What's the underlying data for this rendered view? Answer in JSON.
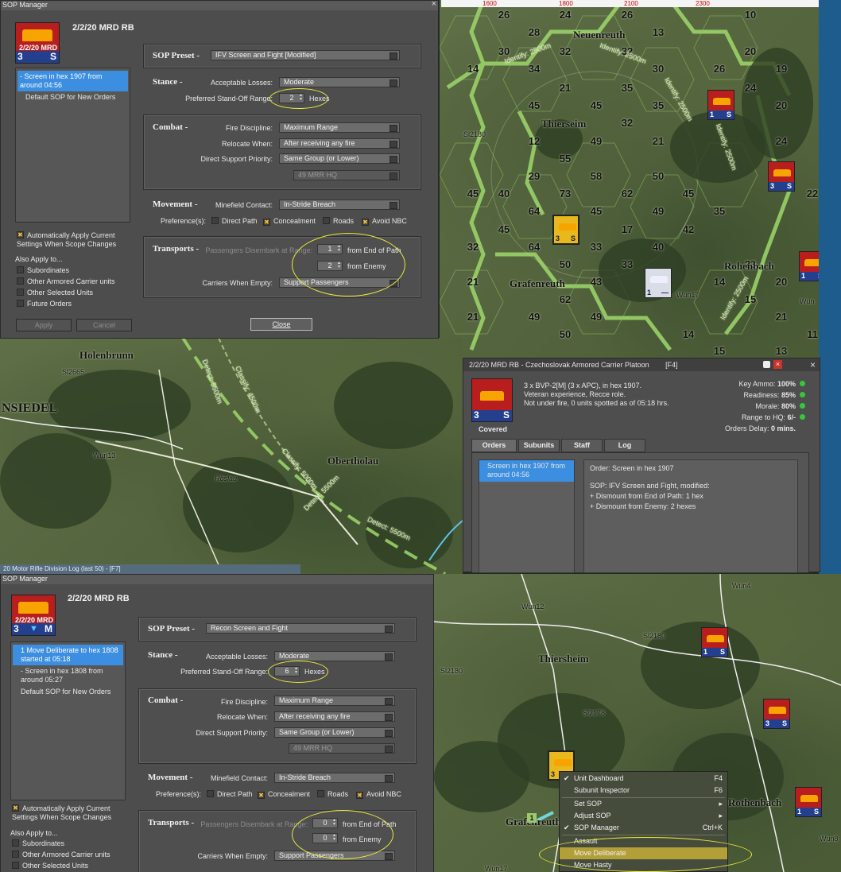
{
  "top_map": {
    "ruler": [
      "1600",
      "1800",
      "2100",
      "2300"
    ],
    "hex_numbers": [
      "26",
      "24",
      "26",
      "10",
      "28",
      "32",
      "13",
      "30",
      "32",
      "30",
      "20",
      "14",
      "34",
      "21",
      "35",
      "26",
      "24",
      "19",
      "45",
      "45",
      "35",
      "20",
      "12",
      "49",
      "32",
      "24",
      "29",
      "55",
      "58",
      "50",
      "40",
      "73",
      "62",
      "45",
      "35",
      "22",
      "64",
      "45",
      "49",
      "42",
      "45",
      "64",
      "33",
      "17",
      "32",
      "50",
      "33",
      "23",
      "20",
      "21",
      "43",
      "21",
      "14",
      "15",
      "62",
      "49",
      "49",
      "21",
      "50",
      "14",
      "21",
      "11",
      "15",
      "13",
      "40",
      "45"
    ],
    "towns": [
      "Neuenreuth",
      "Thierseim",
      "Grafenreuth",
      "Rohenbach"
    ],
    "roads": [
      "Sl2180",
      "Wun17",
      "Wun"
    ],
    "detect": [
      "Identify: 2500m",
      "Identify: 2500m",
      "Identify: 2500m",
      "Identify: 2500m",
      "Identify: 2500m"
    ]
  },
  "mid_map": {
    "towns": [
      "Holenbrunn",
      "NSIEDEL",
      "Obertholau"
    ],
    "roads": [
      "Sl2665",
      "Wun13",
      "Röslau"
    ],
    "detect": [
      "Detect: 5500m",
      "Classify: 4500m",
      "Classify: 5000m",
      "Detect: 5500m",
      "Detect: 5500m"
    ],
    "log_title": "20 Motor Rifle Division Log (last 50) - [F7]"
  },
  "sop1": {
    "title": "SOP Manager",
    "unit": "2/2/20 MRD RB",
    "counter": {
      "top": "T",
      "label": "2/2/20 MRD",
      "size": "3",
      "type": "S"
    },
    "list": [
      "Screen in hex 1907 from around 04:56",
      "Default SOP for New Orders"
    ],
    "preset_label": "SOP Preset -",
    "preset": "IFV Screen and Fight [Modified]",
    "stance_label": "Stance -",
    "losses_label": "Acceptable Losses:",
    "losses": "Moderate",
    "standoff_label": "Preferred Stand-Off Range:",
    "standoff": "2",
    "hexes": "Hexes",
    "combat_label": "Combat -",
    "fire_label": "Fire Discipline:",
    "fire": "Maximum Range",
    "relocate_label": "Relocate When:",
    "relocate": "After receiving any fire",
    "support_label": "Direct Support Priority:",
    "support": "Same Group (or Lower)",
    "hq": "49 MRR HQ",
    "move_label": "Movement -",
    "minefield_label": "Minefield Contact:",
    "minefield": "In-Stride Breach",
    "prefs_label": "Preference(s):",
    "prefs": [
      "Direct Path",
      "Concealment",
      "Roads",
      "Avoid NBC"
    ],
    "trans_label": "Transports -",
    "disembark_label": "Passengers Disembark at Range:",
    "end_val": "1",
    "end_label": "from End of Path",
    "enemy_val": "2",
    "enemy_label": "from Enemy",
    "carriers_label": "Carriers When Empty:",
    "carriers": "Support Passengers",
    "auto": "Automatically Apply Current Settings When Scope Changes",
    "also": "Also Apply to...",
    "also_items": [
      "Subordinates",
      "Other Armored Carrier units",
      "Other Selected Units",
      "Future Orders"
    ],
    "apply": "Apply",
    "cancel": "Cancel",
    "close": "Close"
  },
  "info": {
    "title": "2/2/20 MRD RB - Czechoslovak Armored Carrier Platoon",
    "key": "[F4]",
    "covered": "Covered",
    "line1": "3 x BVP-2[M] (3 x APC), in hex 1907.",
    "line2": "Veteran experience, Recce role.",
    "line3": "Not under fire, 0 units spotted as of 05:18 hrs.",
    "stats": [
      {
        "k": "Key Ammo:",
        "v": "100%"
      },
      {
        "k": "Readiness:",
        "v": "85%"
      },
      {
        "k": "Morale:",
        "v": "80%"
      },
      {
        "k": "Range to HQ:",
        "v": "6/-"
      },
      {
        "k": "Orders Delay:",
        "v": "0 mins."
      }
    ],
    "tabs": [
      "Orders",
      "Subunits",
      "Staff",
      "Log"
    ],
    "order_item": "Screen in hex 1907 from around 04:56",
    "order_lines": [
      "Order: Screen in hex 1907",
      "SOP: IFV Screen and Fight, modified:",
      "+ Dismount from End of Path: 1 hex",
      "+ Dismount from Enemy: 2 hexes"
    ]
  },
  "sop2": {
    "title": "SOP Manager",
    "unit": "2/2/20 MRD RB",
    "counter": {
      "top": "T",
      "label": "2/2/20 MRD",
      "size": "3",
      "type": "M"
    },
    "list": [
      "1 Move Deliberate to hex 1808 started at 05:18",
      "- Screen in hex 1808 from around 05:27",
      "Default SOP for New Orders"
    ],
    "preset": "Recon Screen and Fight",
    "standoff": "6",
    "end_val": "0",
    "enemy_val": "0",
    "also_items": [
      "Subordinates",
      "Other Armored Carrier units",
      "Other Selected Units"
    ]
  },
  "bottom_map": {
    "towns": [
      "Thiersheim",
      "Grafenreuth",
      "Rothenbach"
    ],
    "roads": [
      "Wun4",
      "Wun12",
      "Sl2180",
      "Sl2180",
      "Sl2178",
      "Wun8",
      "Wun17"
    ],
    "hex_label": "1"
  },
  "menu": [
    {
      "label": "Unit Dashboard",
      "key": "F4",
      "check": true
    },
    {
      "label": "Subunit Inspector",
      "key": "F6"
    },
    {
      "label": "Set SOP",
      "sub": true
    },
    {
      "label": "Adjust SOP",
      "sub": true
    },
    {
      "label": "SOP Manager",
      "key": "Ctrl+K",
      "check": true
    },
    {
      "label": "Assault"
    },
    {
      "label": "Move Deliberate",
      "hl": true
    },
    {
      "label": "Move Hasty"
    }
  ]
}
